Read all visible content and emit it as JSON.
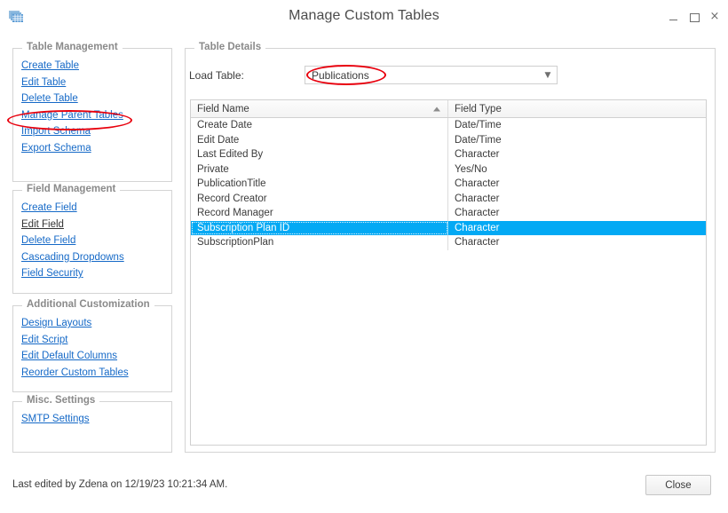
{
  "window": {
    "title": "Manage Custom Tables",
    "icon": "table-grid-icon",
    "minimize_label": "_",
    "maximize_label": "□",
    "close_label": "×"
  },
  "panels": {
    "table_management": {
      "title": "Table Management",
      "items": [
        {
          "label": "Create Table",
          "state": "link"
        },
        {
          "label": "Edit Table",
          "state": "link"
        },
        {
          "label": "Delete Table",
          "state": "link"
        },
        {
          "label": "Manage Parent Tables",
          "state": "link"
        },
        {
          "label": "Import Schema",
          "state": "link"
        },
        {
          "label": "Export Schema",
          "state": "link"
        }
      ]
    },
    "field_management": {
      "title": "Field Management",
      "items": [
        {
          "label": "Create Field",
          "state": "link"
        },
        {
          "label": "Edit Field",
          "state": "dark"
        },
        {
          "label": "Delete Field",
          "state": "link"
        },
        {
          "label": "Cascading Dropdowns",
          "state": "link"
        },
        {
          "label": "Field Security",
          "state": "link"
        }
      ]
    },
    "additional_customization": {
      "title": "Additional Customization",
      "items": [
        {
          "label": "Design Layouts",
          "state": "link"
        },
        {
          "label": "Edit Script",
          "state": "link"
        },
        {
          "label": "Edit Default Columns",
          "state": "link"
        },
        {
          "label": "Reorder Custom Tables",
          "state": "link"
        }
      ]
    },
    "misc_settings": {
      "title": "Misc. Settings",
      "items": [
        {
          "label": "SMTP Settings",
          "state": "link"
        }
      ]
    },
    "table_details": {
      "title": "Table Details"
    }
  },
  "load_table": {
    "label": "Load Table:",
    "value": "Publications",
    "arrow_icon": "chevron-down-icon"
  },
  "grid": {
    "columns": [
      {
        "label": "Field Name",
        "sorted": "ascending",
        "sort_icon": "sort-ascending-icon"
      },
      {
        "label": "Field Type",
        "sorted": "none"
      }
    ],
    "rows": [
      {
        "field_name": "Create Date",
        "field_type": "Date/Time",
        "selected": false
      },
      {
        "field_name": "Edit Date",
        "field_type": "Date/Time",
        "selected": false
      },
      {
        "field_name": "Last Edited By",
        "field_type": "Character",
        "selected": false
      },
      {
        "field_name": "Private",
        "field_type": "Yes/No",
        "selected": false
      },
      {
        "field_name": "PublicationTitle",
        "field_type": "Character",
        "selected": false
      },
      {
        "field_name": "Record Creator",
        "field_type": "Character",
        "selected": false
      },
      {
        "field_name": "Record Manager",
        "field_type": "Character",
        "selected": false
      },
      {
        "field_name": "Subscription Plan ID",
        "field_type": "Character",
        "selected": true
      },
      {
        "field_name": "SubscriptionPlan",
        "field_type": "Character",
        "selected": false
      }
    ]
  },
  "footer": {
    "last_edited": "Last edited by Zdena on 12/19/23 10:21:34 AM.",
    "close_button": "Close"
  },
  "annotations": [
    {
      "name": "highlight-manage-parent-tables",
      "shape": "ellipse"
    },
    {
      "name": "highlight-load-table-value",
      "shape": "ellipse"
    }
  ],
  "colors": {
    "link": "#1569c7",
    "selection": "#03a9f4",
    "annotation": "#e8000d",
    "group_title": "#8a8a8a"
  }
}
